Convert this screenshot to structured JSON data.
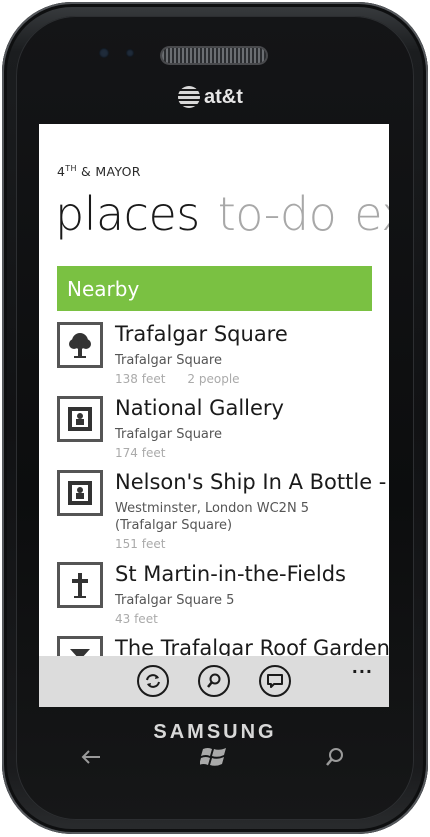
{
  "device": {
    "carrier": "at&t",
    "brand": "SAMSUNG",
    "hardware_buttons": [
      "back-arrow-icon",
      "windows-logo-icon",
      "search-icon"
    ]
  },
  "app": {
    "title_main": "4",
    "title_sup": "TH",
    "title_rest": " & MAYOR",
    "pivots": [
      "places",
      "to-do",
      "ex"
    ],
    "accent_color": "#7ac142"
  },
  "group": {
    "label": "Nearby"
  },
  "places": [
    {
      "name": "Trafalgar Square",
      "sub": [
        "Trafalgar Square"
      ],
      "meta": [
        "138 feet",
        "2 people"
      ],
      "icon": "tree-icon"
    },
    {
      "name": "National Gallery",
      "sub": [
        "Trafalgar Square"
      ],
      "meta": [
        "174 feet"
      ],
      "icon": "museum-frame-icon"
    },
    {
      "name": "Nelson's Ship In A Bottle -",
      "sub": [
        "Westminster, London WC2N 5",
        "(Trafalgar Square)"
      ],
      "meta": [
        "151 feet"
      ],
      "icon": "museum-frame-icon"
    },
    {
      "name": "St Martin-in-the-Fields",
      "sub": [
        "Trafalgar Square 5"
      ],
      "meta": [
        "43 feet"
      ],
      "icon": "church-cross-icon"
    },
    {
      "name": "The Trafalgar Roof Garden",
      "sub": [],
      "meta": [],
      "icon": "bar-glass-icon"
    }
  ],
  "appbar": {
    "buttons": [
      "refresh-icon",
      "search-icon",
      "comment-icon"
    ],
    "more": "..."
  }
}
